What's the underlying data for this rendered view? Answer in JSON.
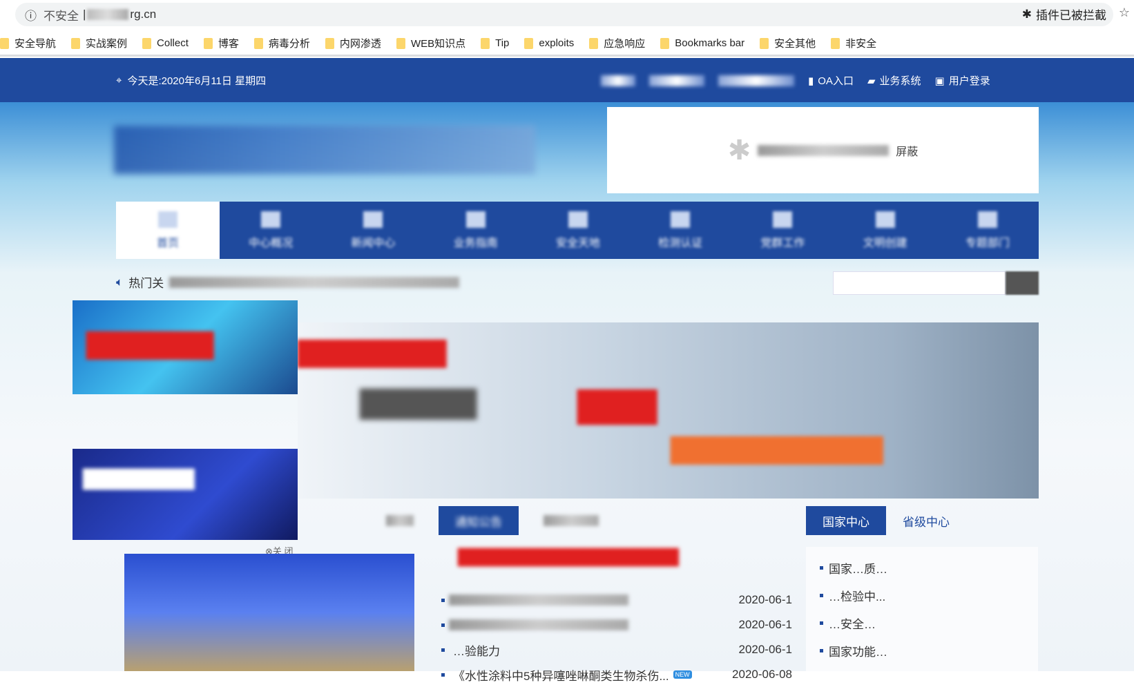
{
  "browser": {
    "security": "不安全",
    "url_suffix": "rg.cn",
    "plugin_blocked": "插件已被拦截"
  },
  "bookmarks": [
    "安全导航",
    "实战案例",
    "Collect",
    "博客",
    "病毒分析",
    "内网渗透",
    "WEB知识点",
    "Tip",
    "exploits",
    "应急响应",
    "Bookmarks bar",
    "安全其他",
    "非安全"
  ],
  "header": {
    "date": "今天是:2020年6月11日  星期四",
    "links": [
      "新闻",
      "OA入口",
      "业务系统",
      "用户登录"
    ]
  },
  "ad_box": {
    "text": "屏蔽"
  },
  "nav": [
    "首页",
    "中心概况",
    "新闻中心",
    "业务指南",
    "安全天地",
    "检测认证",
    "党群工作",
    "文明创建",
    "专题部门"
  ],
  "hot": {
    "label": "热门关"
  },
  "ad_close": "⊗关 闭",
  "tabs": [
    "通知公告",
    "国家中心",
    "省级中心"
  ],
  "news": [
    {
      "title": "",
      "date": "2020-06-1"
    },
    {
      "title": "",
      "date": "2020-06-1"
    },
    {
      "title": "…验能力",
      "date": "2020-06-1"
    },
    {
      "title": "《水性涂料中5种异噻唑啉酮类生物杀伤...",
      "date": "2020-06-08",
      "badge": "NEW"
    }
  ],
  "right_list": [
    "国家…质…",
    "…检验中...",
    "…安全…",
    "国家功能…"
  ],
  "colors": {
    "brand": "#1f4a9e"
  }
}
